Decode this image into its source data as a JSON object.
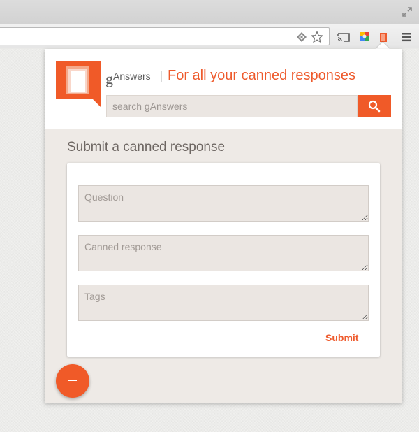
{
  "browser": {
    "icons": [
      "restore-window-icon",
      "translate-icon",
      "bookmark-star-icon",
      "cast-icon",
      "extension-puzzle-icon",
      "ganswers-extension-icon",
      "menu-icon"
    ]
  },
  "popup": {
    "brand": {
      "g": "g",
      "rest": "Answers"
    },
    "tagline": "For all your canned responses",
    "search": {
      "placeholder": "search gAnswers",
      "icon": "search-icon"
    },
    "section_title": "Submit a canned response",
    "form": {
      "question_placeholder": "Question",
      "response_placeholder": "Canned response",
      "tags_placeholder": "Tags",
      "submit_label": "Submit"
    },
    "fab": {
      "icon": "minus-icon"
    }
  },
  "colors": {
    "accent": "#f05a28",
    "field_bg": "#ebe6e2",
    "panel_bg": "#eeeae6"
  }
}
